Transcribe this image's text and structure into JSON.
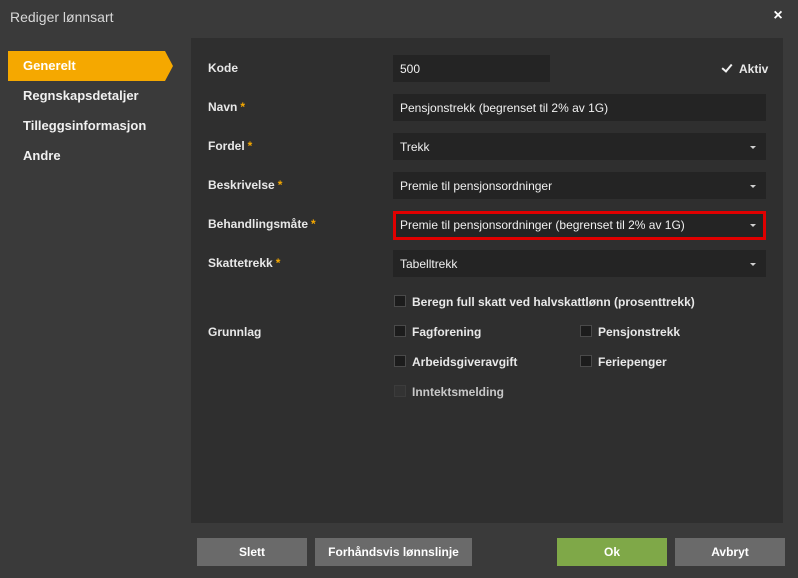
{
  "dialog": {
    "title": "Rediger lønnsart",
    "close_icon": "×"
  },
  "sidebar": {
    "items": [
      {
        "label": "Generelt",
        "active": true
      },
      {
        "label": "Regnskapsdetaljer"
      },
      {
        "label": "Tilleggsinformasjon"
      },
      {
        "label": "Andre"
      }
    ]
  },
  "form": {
    "kode": {
      "label": "Kode",
      "value": "500"
    },
    "aktiv": {
      "label": "Aktiv",
      "checked": true
    },
    "navn": {
      "label": "Navn",
      "required": "*",
      "value": "Pensjonstrekk (begrenset til 2% av 1G)"
    },
    "fordel": {
      "label": "Fordel",
      "required": "*",
      "value": "Trekk"
    },
    "beskrivelse": {
      "label": "Beskrivelse",
      "required": "*",
      "value": "Premie til pensjonsordninger"
    },
    "behandlingsmate": {
      "label": "Behandlingsmåte",
      "required": "*",
      "value": "Premie til pensjonsordninger (begrenset til 2% av 1G)",
      "highlight_color": "#e00000"
    },
    "skattetrekk": {
      "label": "Skattetrekk",
      "required": "*",
      "value": "Tabelltrekk"
    },
    "full_skatt": {
      "label": "Beregn full skatt ved halvskattlønn (prosenttrekk)",
      "checked": false
    },
    "grunnlag": {
      "label": "Grunnlag",
      "options": {
        "fagforening": "Fagforening",
        "pensjonstrekk": "Pensjonstrekk",
        "arbeidsgiveravgift": "Arbeidsgiveravgift",
        "feriepenger": "Feriepenger",
        "inntektsmelding": "Inntektsmelding"
      }
    }
  },
  "footer": {
    "slett": "Slett",
    "forhandsvis": "Forhåndsvis lønnslinje",
    "ok": "Ok",
    "avbryt": "Avbryt"
  },
  "colors": {
    "accent": "#f5a800",
    "ok_button": "#7fa848",
    "highlight": "#e00000"
  }
}
